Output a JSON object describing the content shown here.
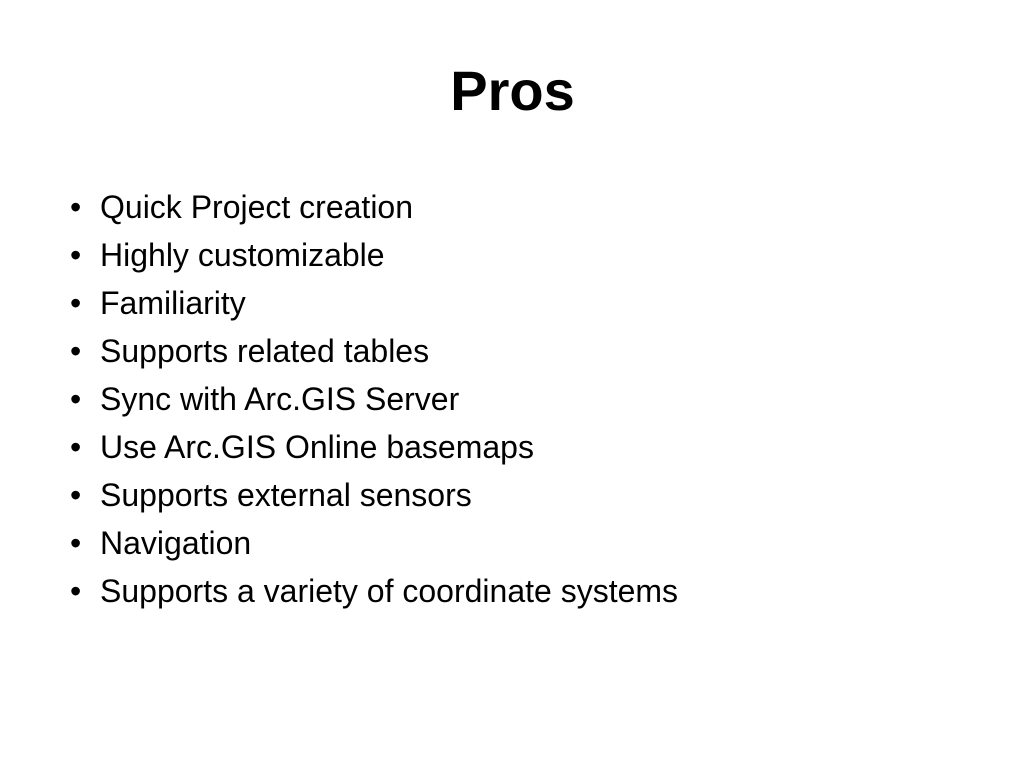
{
  "slide": {
    "title": "Pros",
    "bullets": [
      "Quick Project creation",
      "Highly customizable",
      "Familiarity",
      "Supports related tables",
      "Sync with Arc.GIS Server",
      "Use Arc.GIS Online basemaps",
      "Supports external sensors",
      "Navigation",
      "Supports a variety of coordinate systems"
    ]
  }
}
